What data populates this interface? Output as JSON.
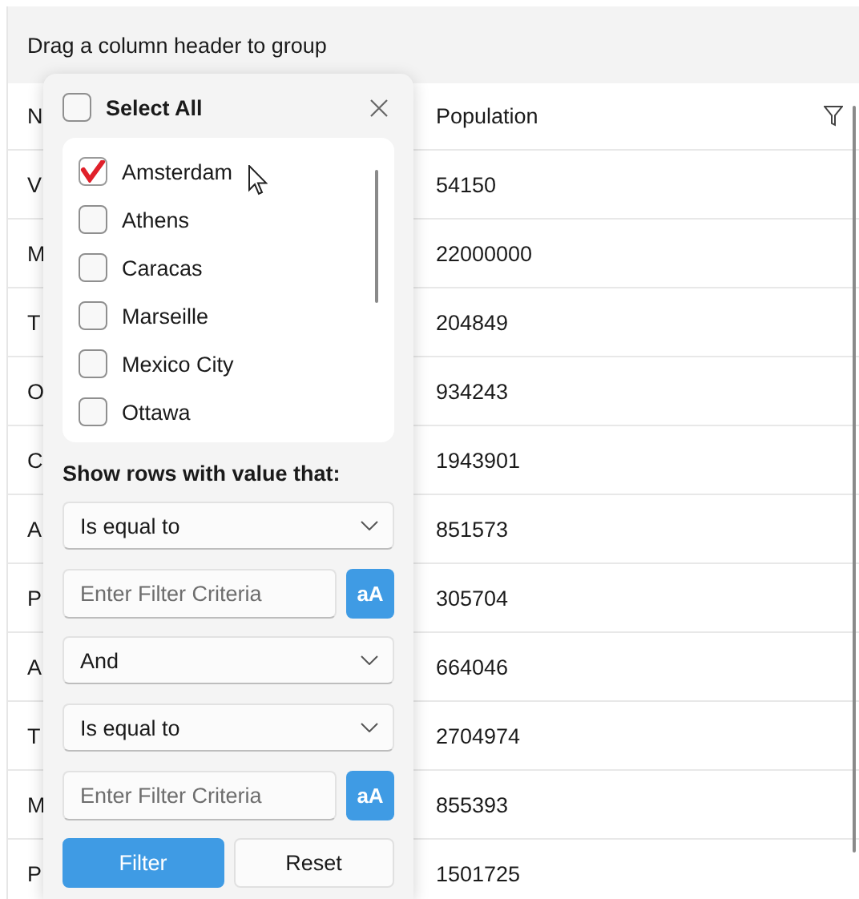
{
  "group_panel": {
    "text": "Drag a column header to group"
  },
  "grid": {
    "columns": [
      "N",
      "Population"
    ],
    "rows": [
      [
        "V",
        "54150"
      ],
      [
        "M",
        "22000000"
      ],
      [
        "T",
        "204849"
      ],
      [
        "O",
        "934243"
      ],
      [
        "C",
        "1943901"
      ],
      [
        "A",
        "851573"
      ],
      [
        "P",
        "305704"
      ],
      [
        "A",
        "664046"
      ],
      [
        "T",
        "2704974"
      ],
      [
        "M",
        "855393"
      ],
      [
        "P",
        "1501725"
      ]
    ]
  },
  "filter_popup": {
    "select_all": {
      "label": "Select All",
      "checked": false
    },
    "items": [
      {
        "label": "Amsterdam",
        "checked": true
      },
      {
        "label": "Athens",
        "checked": false
      },
      {
        "label": "Caracas",
        "checked": false
      },
      {
        "label": "Marseille",
        "checked": false
      },
      {
        "label": "Mexico City",
        "checked": false
      },
      {
        "label": "Ottawa",
        "checked": false
      }
    ],
    "section_title": "Show rows with value that:",
    "conditions": [
      {
        "kind": "dropdown",
        "value": "Is equal to"
      },
      {
        "kind": "input",
        "placeholder": "Enter Filter Criteria",
        "case_button": "aA"
      },
      {
        "kind": "dropdown",
        "value": "And"
      },
      {
        "kind": "dropdown",
        "value": "Is equal to"
      },
      {
        "kind": "input",
        "placeholder": "Enter Filter Criteria",
        "case_button": "aA"
      }
    ],
    "buttons": [
      {
        "label": "Filter",
        "primary": true
      },
      {
        "label": "Reset",
        "primary": false
      }
    ]
  }
}
